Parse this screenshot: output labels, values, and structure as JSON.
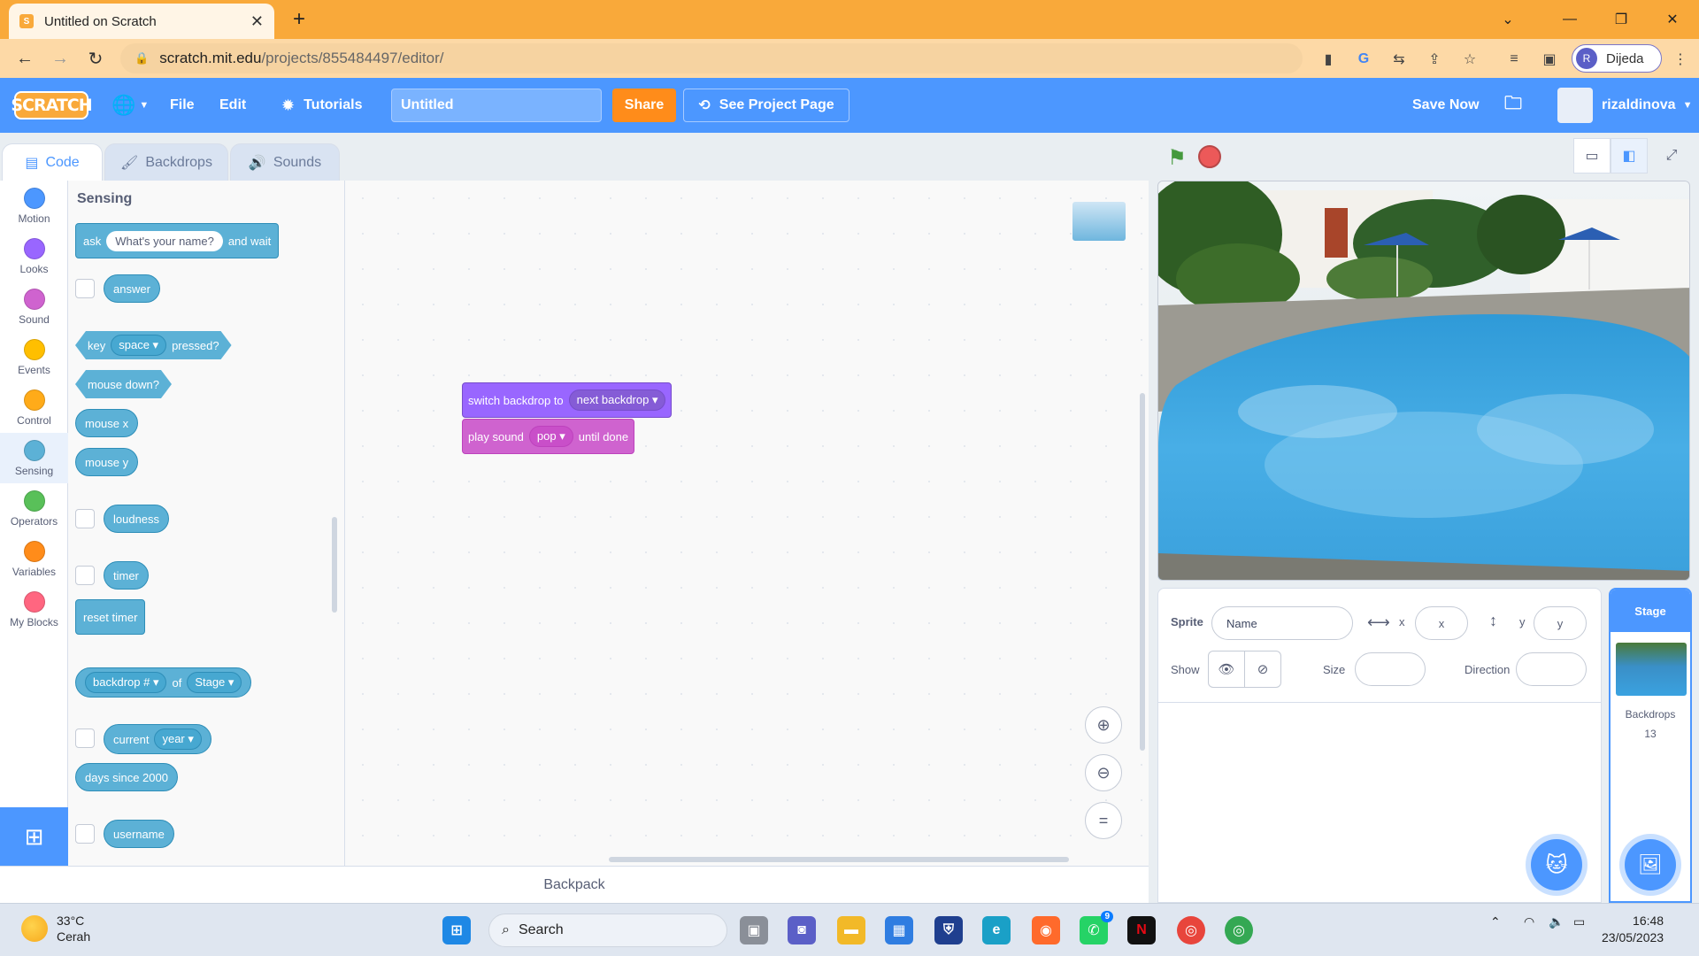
{
  "browser": {
    "tab_title": "Untitled on Scratch",
    "url_host": "scratch.mit.edu",
    "url_path": "/projects/855484497/editor/",
    "profile_initial": "R",
    "profile_name": "Dijeda"
  },
  "menubar": {
    "logo": "SCRATCH",
    "file": "File",
    "edit": "Edit",
    "tutorials": "Tutorials",
    "project_title": "Untitled",
    "share": "Share",
    "see_project_page": "See Project Page",
    "save_now": "Save Now",
    "username": "rizaldinova"
  },
  "editor_tabs": {
    "code": "Code",
    "backdrops": "Backdrops",
    "sounds": "Sounds"
  },
  "categories": [
    {
      "label": "Motion",
      "color": "#4c97ff"
    },
    {
      "label": "Looks",
      "color": "#9966ff"
    },
    {
      "label": "Sound",
      "color": "#cf63cf"
    },
    {
      "label": "Events",
      "color": "#ffbf00"
    },
    {
      "label": "Control",
      "color": "#ffab19"
    },
    {
      "label": "Sensing",
      "color": "#5cb1d6"
    },
    {
      "label": "Operators",
      "color": "#59c059"
    },
    {
      "label": "Variables",
      "color": "#ff8c1a"
    },
    {
      "label": "My Blocks",
      "color": "#ff6680"
    }
  ],
  "palette": {
    "heading": "Sensing",
    "ask": "ask",
    "ask_default": "What's your name?",
    "and_wait": "and wait",
    "answer": "answer",
    "key": "key",
    "key_value": "space",
    "pressed": "pressed?",
    "mouse_down": "mouse down?",
    "mouse_x": "mouse x",
    "mouse_y": "mouse y",
    "loudness": "loudness",
    "timer": "timer",
    "reset_timer": "reset timer",
    "backdrop_num": "backdrop #",
    "of": "of",
    "stage": "Stage",
    "current": "current",
    "year": "year",
    "days_since": "days since 2000",
    "username": "username"
  },
  "workspace": {
    "switch_backdrop": "switch backdrop to",
    "next_backdrop": "next backdrop",
    "play_sound": "play sound",
    "pop": "pop",
    "until_done": "until done"
  },
  "backpack": "Backpack",
  "sprite_info": {
    "sprite_label": "Sprite",
    "name_placeholder": "Name",
    "x_label": "x",
    "x_placeholder": "x",
    "y_label": "y",
    "y_placeholder": "y",
    "show_label": "Show",
    "size_label": "Size",
    "direction_label": "Direction"
  },
  "stage_pane": {
    "title": "Stage",
    "backdrops_label": "Backdrops",
    "backdrops_count": "13"
  },
  "taskbar": {
    "temp": "33°C",
    "weather": "Cerah",
    "search": "Search",
    "time": "16:48",
    "date": "23/05/2023",
    "whatsapp_badge": "9"
  }
}
